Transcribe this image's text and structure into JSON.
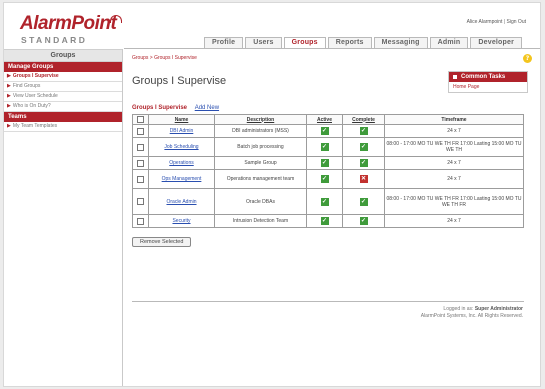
{
  "brand": {
    "name": "AlarmPoint",
    "edition": "STANDARD",
    "accent": "#b0232b"
  },
  "user_bar": {
    "user_label": "Alice Alarmpoint",
    "separator": "|",
    "sign_out": "Sign Out"
  },
  "tabs": [
    {
      "label": "Profile",
      "active": false
    },
    {
      "label": "Users",
      "active": false
    },
    {
      "label": "Groups",
      "active": true
    },
    {
      "label": "Reports",
      "active": false
    },
    {
      "label": "Messaging",
      "active": false
    },
    {
      "label": "Admin",
      "active": false
    },
    {
      "label": "Developer",
      "active": false
    }
  ],
  "sidebar": {
    "heading": "Groups",
    "section1": "Manage Groups",
    "items1": [
      {
        "label": "Groups I Supervise",
        "active": true
      },
      {
        "label": "Find Groups",
        "active": false
      },
      {
        "label": "View User Schedule",
        "active": false
      },
      {
        "label": "Who is On Duty?",
        "active": false
      }
    ],
    "section2": "Teams",
    "items2": [
      {
        "label": "My Team Templates",
        "active": false
      }
    ]
  },
  "main": {
    "breadcrumb": "Groups > Groups I Supervise",
    "title": "Groups I Supervise",
    "subhead_label": "Groups I Supervise",
    "add_new": "Add New",
    "common_tasks": {
      "title": "Common Tasks",
      "items": [
        "Home Page"
      ]
    },
    "table": {
      "headers": [
        "Name",
        "Description",
        "Active",
        "Complete",
        "Timeframe"
      ],
      "rows": [
        {
          "name": "DBI Admin",
          "description": "DBI administrators (MSS)",
          "active": true,
          "complete": true,
          "timeframe": "24 x 7"
        },
        {
          "name": "Job Scheduling",
          "description": "Batch job processing",
          "active": true,
          "complete": true,
          "timeframe": "08:00 - 17:00 MO TU WE TH FR 17:00 Lasting 15:00 MO TU WE TH"
        },
        {
          "name": "Operations",
          "description": "Sample Group",
          "active": true,
          "complete": true,
          "timeframe": "24 x 7"
        },
        {
          "name": "Ops Management",
          "description": "Operations management team",
          "active": true,
          "complete": false,
          "timeframe": "24 x 7"
        },
        {
          "name": "Oracle Admin",
          "description": "Oracle DBAs",
          "active": true,
          "complete": true,
          "timeframe": "08:00 - 17:00 MO TU WE TH FR 17:00 Lasting 15:00 MO TU WE TH FR"
        },
        {
          "name": "Security",
          "description": "Intrusion Detection Team",
          "active": true,
          "complete": true,
          "timeframe": "24 x 7"
        }
      ]
    },
    "remove_button": "Remove Selected"
  },
  "footer": {
    "line1_prefix": "Logged in as:",
    "line1_user": "Super Administrator",
    "line2": "AlarmPoint Systems, Inc. All Rights Reserved."
  }
}
